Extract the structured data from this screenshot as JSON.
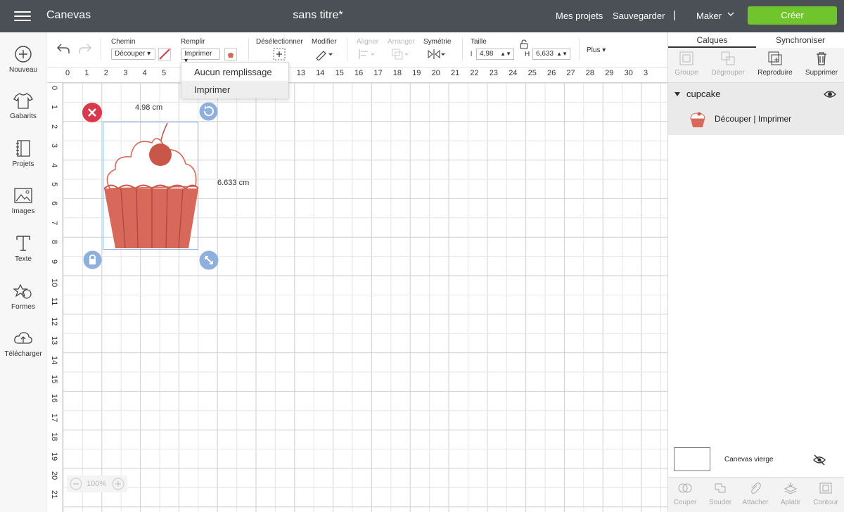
{
  "header": {
    "app_title": "Canevas",
    "doc_title": "sans titre*",
    "my_projects": "Mes projets",
    "save": "Sauvegarder",
    "separator": "|",
    "machine": "Maker",
    "create_button": "Créer"
  },
  "sidebar": {
    "items": [
      {
        "label": "Nouveau",
        "icon": "plus-circle-icon"
      },
      {
        "label": "Gabarits",
        "icon": "tshirt-icon"
      },
      {
        "label": "Projets",
        "icon": "notebook-icon"
      },
      {
        "label": "Images",
        "icon": "image-icon"
      },
      {
        "label": "Texte",
        "icon": "text-t-icon"
      },
      {
        "label": "Formes",
        "icon": "shapes-icon"
      },
      {
        "label": "Télécharger",
        "icon": "cloud-upload-icon"
      }
    ]
  },
  "toolbar": {
    "path_label": "Chemin",
    "path_value": "Découper",
    "fill_label": "Remplir",
    "fill_value": "Imprimer",
    "deselect_label": "Désélectionner",
    "modify_label": "Modifier",
    "align_label": "Aligner",
    "arrange_label": "Arranger",
    "symmetry_label": "Symétrie",
    "size_label": "Taille",
    "width_prefix": "l",
    "width_value": "4,98",
    "height_prefix": "H",
    "height_value": "6,633",
    "more_label": "Plus"
  },
  "fill_dropdown": {
    "options": [
      "Aucun remplissage",
      "Imprimer"
    ],
    "selected": "Imprimer"
  },
  "ruler": {
    "top": [
      "0",
      "1",
      "2",
      "3",
      "4",
      "5",
      "",
      "",
      "",
      "",
      "",
      "12",
      "13",
      "14",
      "15",
      "16",
      "17",
      "18",
      "19",
      "20",
      "21",
      "22",
      "23",
      "24",
      "25",
      "26",
      "27",
      "28",
      "29",
      "30",
      "3"
    ],
    "left": [
      "0",
      "1",
      "2",
      "3",
      "4",
      "5",
      "6",
      "7",
      "8",
      "9",
      "10",
      "11",
      "12",
      "13",
      "14",
      "15",
      "16",
      "17",
      "18",
      "19",
      "20",
      "21"
    ]
  },
  "canvas": {
    "width_label": "4.98 cm",
    "height_label": "6.633 cm",
    "zoom": "100%"
  },
  "right_panel": {
    "tabs": [
      "Calques",
      "Synchroniser"
    ],
    "tools": [
      "Groupe",
      "Dégrouper",
      "Reproduire",
      "Supprimer"
    ],
    "layer_group_name": "cupcake",
    "layer_item_text": "Découper  | Imprimer",
    "blank_canvas": "Canevas vierge",
    "bottom_tools": [
      "Couper",
      "Souder",
      "Attacher",
      "Aplatir",
      "Contour"
    ]
  },
  "colors": {
    "topbar": "#4a5056",
    "create": "#70c52d",
    "cupcake": "#d8695a",
    "handle_blue": "#8fb0dd",
    "handle_red": "#d8394c"
  }
}
